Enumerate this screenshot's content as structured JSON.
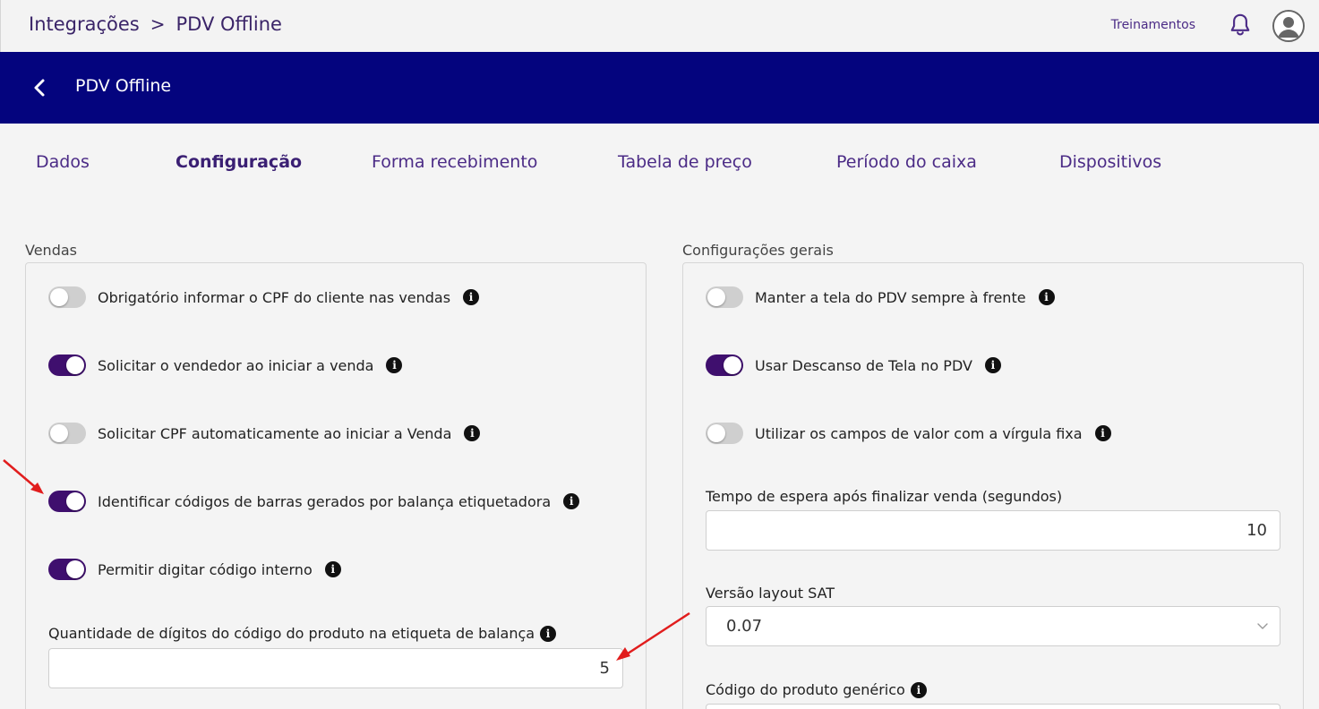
{
  "topbar": {
    "breadcrumb_root": "Integrações",
    "breadcrumb_sep": ">",
    "breadcrumb_current": "PDV Offline",
    "trainings_link": "Treinamentos",
    "bell_icon": "bell-icon",
    "avatar_icon": "user-avatar-icon"
  },
  "header": {
    "title": "PDV Offline",
    "back_icon": "chevron-left-icon"
  },
  "tabs": [
    {
      "label": "Dados",
      "active": false
    },
    {
      "label": "Configuração",
      "active": true
    },
    {
      "label": "Forma recebimento",
      "active": false
    },
    {
      "label": "Tabela de preço",
      "active": false
    },
    {
      "label": "Período do caixa",
      "active": false
    },
    {
      "label": "Dispositivos",
      "active": false
    }
  ],
  "vendas": {
    "title": "Vendas",
    "toggles": [
      {
        "label": "Obrigatório informar o CPF do cliente nas vendas",
        "on": false
      },
      {
        "label": "Solicitar o vendedor ao iniciar a venda",
        "on": true
      },
      {
        "label": "Solicitar CPF automaticamente ao iniciar a Venda",
        "on": false
      },
      {
        "label": "Identificar códigos de barras gerados por balança etiquetadora",
        "on": true
      },
      {
        "label": "Permitir digitar código interno",
        "on": true
      }
    ],
    "digits_label": "Quantidade de dígitos do código do produto na etiqueta de balança",
    "digits_value": "5"
  },
  "gerais": {
    "title": "Configurações gerais",
    "toggles": [
      {
        "label": "Manter a tela do PDV sempre à frente",
        "on": false
      },
      {
        "label": "Usar Descanso de Tela no PDV",
        "on": true
      },
      {
        "label": "Utilizar os campos de valor com a vírgula fixa",
        "on": false
      }
    ],
    "wait_label": "Tempo de espera após finalizar venda (segundos)",
    "wait_value": "10",
    "sat_label": "Versão layout SAT",
    "sat_value": "0.07",
    "generic_label": "Código do produto genérico"
  },
  "colors": {
    "header": "#04047e",
    "accent": "#3f0f6e",
    "annotation_arrow": "#e11d1d"
  }
}
